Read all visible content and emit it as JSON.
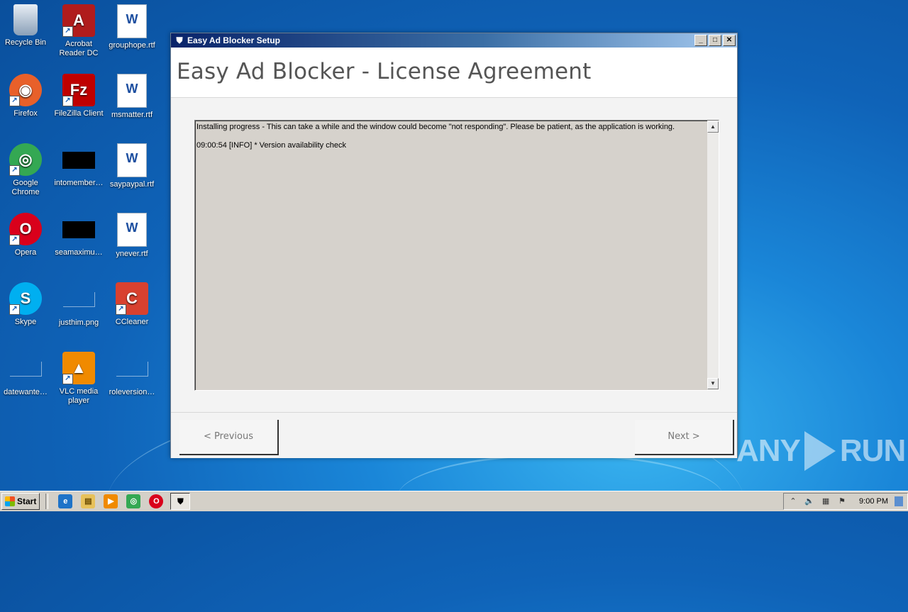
{
  "desktop": {
    "icons": [
      {
        "label": "Recycle Bin",
        "icon": "recycle-bin-icon",
        "color": "#c9d7e6",
        "glyph": "🗑",
        "shortcut": false
      },
      {
        "label": "Acrobat Reader DC",
        "icon": "acrobat-icon",
        "color": "#b01c1c",
        "glyph": "A",
        "shortcut": true
      },
      {
        "label": "grouphope.rtf",
        "icon": "word-doc-icon",
        "color": "#ffffff",
        "glyph": "W",
        "shortcut": false
      },
      {
        "label": "Firefox",
        "icon": "firefox-icon",
        "color": "#e8602a",
        "glyph": "◉",
        "shortcut": true
      },
      {
        "label": "FileZilla Client",
        "icon": "filezilla-icon",
        "color": "#bf0000",
        "glyph": "Fz",
        "shortcut": true
      },
      {
        "label": "msmatter.rtf",
        "icon": "word-doc-icon",
        "color": "#ffffff",
        "glyph": "W",
        "shortcut": false
      },
      {
        "label": "Google Chrome",
        "icon": "chrome-icon",
        "color": "#34a853",
        "glyph": "◎",
        "shortcut": true
      },
      {
        "label": "intomember…",
        "icon": "black-file-icon",
        "color": "#000000",
        "glyph": "",
        "shortcut": false
      },
      {
        "label": "saypaypal.rtf",
        "icon": "word-doc-icon",
        "color": "#ffffff",
        "glyph": "W",
        "shortcut": false
      },
      {
        "label": "Opera",
        "icon": "opera-icon",
        "color": "#d9001b",
        "glyph": "O",
        "shortcut": true
      },
      {
        "label": "seamaximu…",
        "icon": "black-file-icon",
        "color": "#000000",
        "glyph": "",
        "shortcut": false
      },
      {
        "label": "ynever.rtf",
        "icon": "word-doc-icon",
        "color": "#ffffff",
        "glyph": "W",
        "shortcut": false
      },
      {
        "label": "Skype",
        "icon": "skype-icon",
        "color": "#00aff0",
        "glyph": "S",
        "shortcut": true
      },
      {
        "label": "justhim.png",
        "icon": "image-file-icon",
        "color": "transparent",
        "glyph": "",
        "shortcut": false
      },
      {
        "label": "CCleaner",
        "icon": "ccleaner-icon",
        "color": "#d8412f",
        "glyph": "C",
        "shortcut": true
      },
      {
        "label": "datewante…",
        "icon": "image-file-icon",
        "color": "transparent",
        "glyph": "",
        "shortcut": false
      },
      {
        "label": "VLC media player",
        "icon": "vlc-icon",
        "color": "#f08a00",
        "glyph": "▲",
        "shortcut": true
      },
      {
        "label": "roleversion…",
        "icon": "image-file-icon",
        "color": "transparent",
        "glyph": "",
        "shortcut": false
      }
    ]
  },
  "window": {
    "title": "Easy Ad Blocker Setup",
    "heading": "Easy Ad Blocker - License Agreement",
    "log_lines": [
      "Installing progress - This can take a while and the window could become \"not responding\". Please be patient, as the application is working.",
      "09:00:54 [INFO] * Version availability check"
    ],
    "buttons": {
      "previous": "< Previous",
      "next": "Next >"
    },
    "controls": {
      "minimize": "_",
      "maximize": "□",
      "close": "✕"
    }
  },
  "taskbar": {
    "start_label": "Start",
    "clock": "9:00 PM"
  },
  "watermark": {
    "left": "ANY",
    "right": "RUN"
  }
}
